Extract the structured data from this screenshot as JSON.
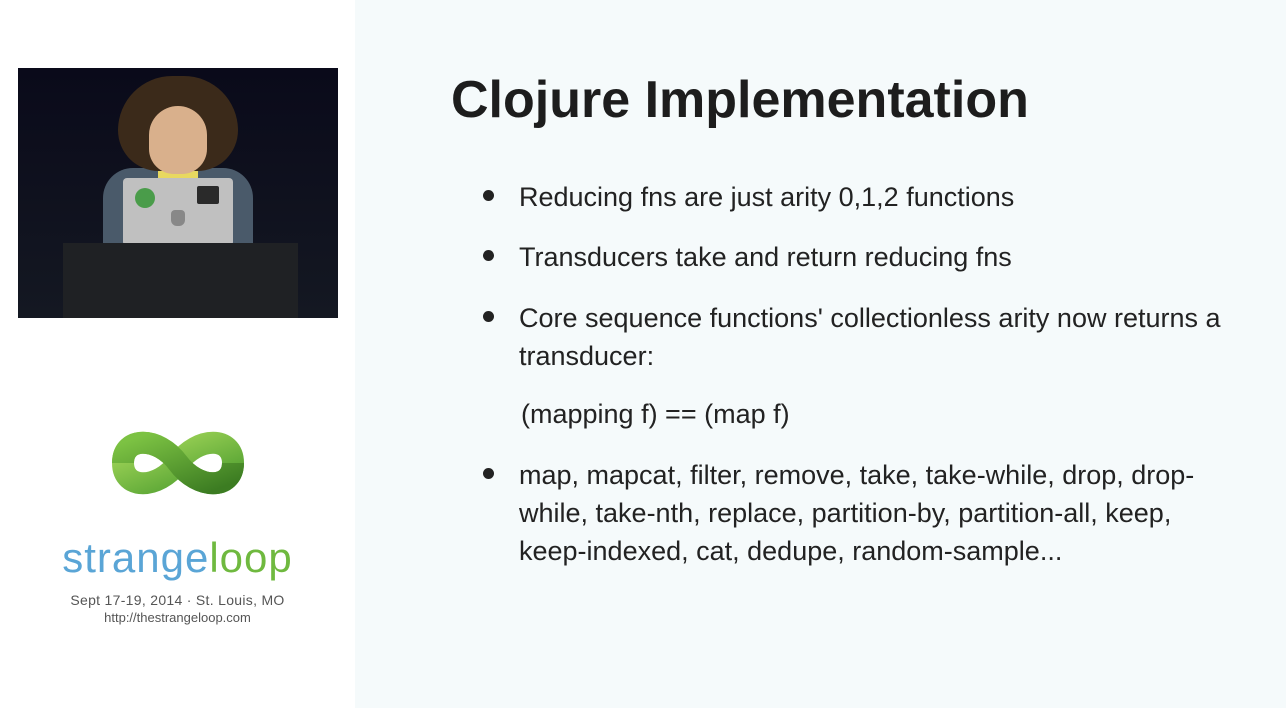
{
  "conference": {
    "brand_part1": "strange",
    "brand_part2": "loop",
    "date_line": "Sept 17-19, 2014   ·   St. Louis, MO",
    "url": "http://thestrangeloop.com"
  },
  "slide": {
    "title": "Clojure Implementation",
    "bullets": [
      "Reducing fns are just arity 0,1,2 functions",
      "Transducers take and return reducing fns",
      "Core sequence functions' collectionless arity now returns a transducer:",
      "map, mapcat, filter, remove, take, take-while, drop, drop-while, take-nth, replace, partition-by,  partition-all, keep, keep-indexed, cat, dedupe, random-sample..."
    ],
    "sub_expression": "(mapping f) == (map f)"
  }
}
